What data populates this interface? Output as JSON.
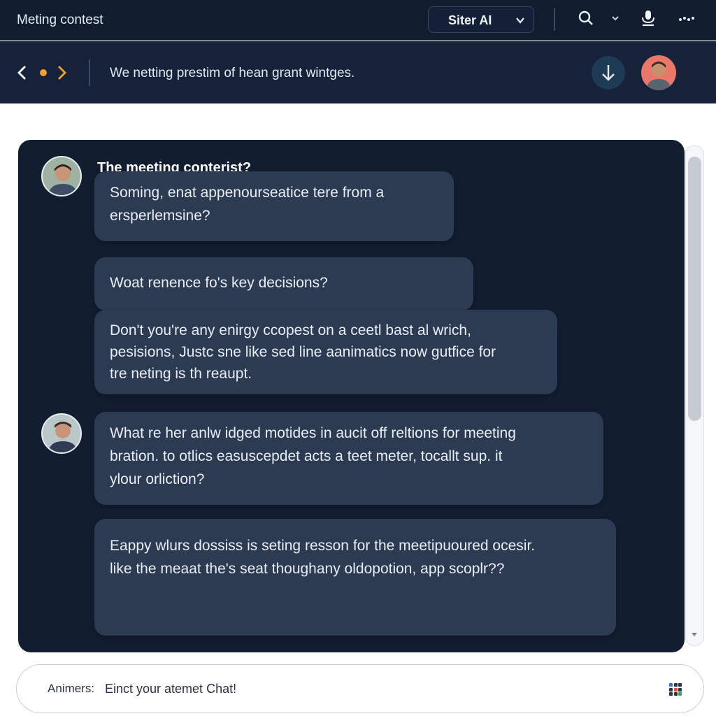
{
  "header": {
    "app_title": "Meting contest",
    "model_select": "Siter AI",
    "icons": [
      "search-icon",
      "dropdown-caret-icon",
      "microphone-icon",
      "more-icon"
    ]
  },
  "subheader": {
    "text": "We netting prestim of hean grant wintges.",
    "icons": [
      "back-icon",
      "status-dot-icon",
      "forward-icon",
      "download-icon",
      "user-avatar"
    ]
  },
  "thread": {
    "title": "The meeting conterist?",
    "messages": [
      {
        "lines": [
          "Soming, enat appenourseatice tere from a",
          "ersperlemsine?"
        ]
      },
      {
        "lines": [
          "Woat renence fo's key decisions?"
        ]
      },
      {
        "lines": [
          "Don't you're any enirgy ccopest on a ceetl bast al wrich,",
          "pesisions, Justc sne like sed line aanimatics now gutfice for",
          "tre neting is th reaupt."
        ]
      },
      {
        "lines": [
          "What re her anlw idged motides in aucit off reltions for meeting",
          "bration. to otlics easuscepdet acts a teet meter, tocallt sup. it",
          "ylour orliction?"
        ]
      },
      {
        "lines": [
          "Eappy wlurs dossiss is seting resson for the meetipuoured ocesir.",
          "like the meaat the's seat thoughany oldopotion, app scoplr??"
        ]
      }
    ]
  },
  "composer": {
    "label": "Animers:",
    "placeholder": "Einct your atemet Chat!"
  },
  "colors": {
    "header_bg": "#111c2e",
    "panel_bg": "#121d30",
    "bubble_bg": "#2c3a52",
    "accent_dot": "#f0a030",
    "avatar_bg": "#e9786a"
  }
}
